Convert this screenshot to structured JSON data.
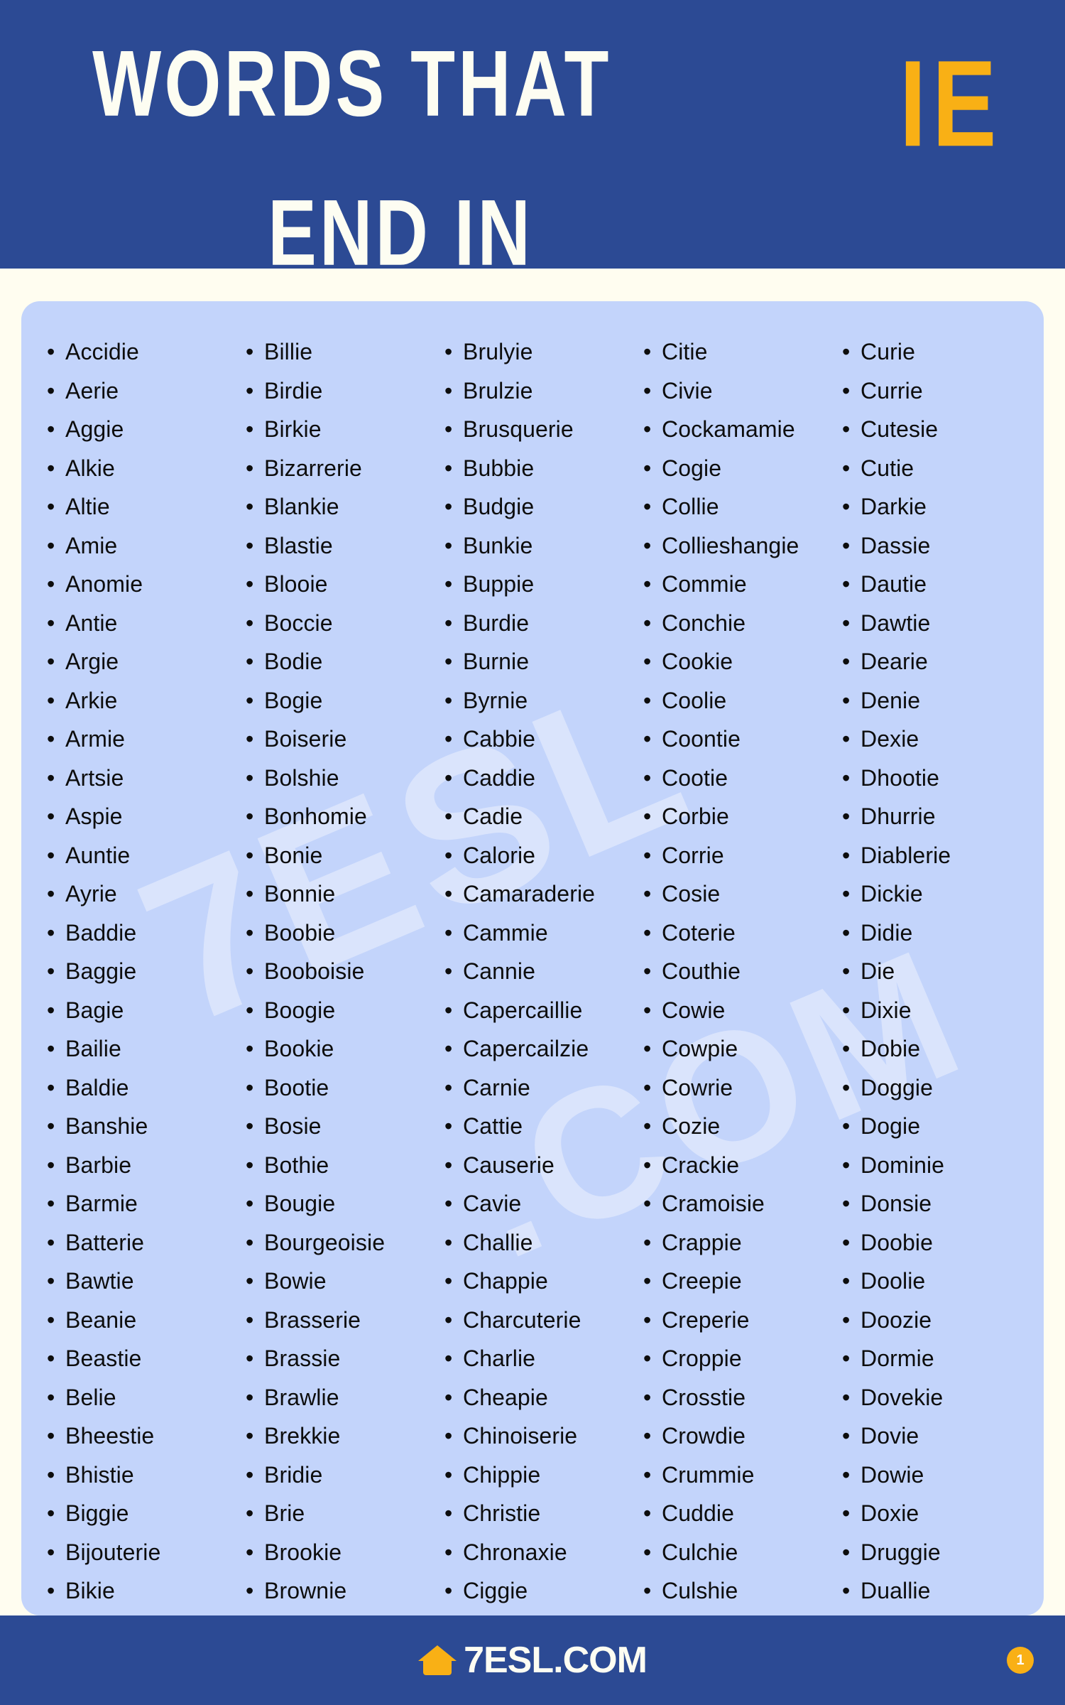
{
  "header": {
    "title_line_1": "WORDS THAT",
    "title_line_2": "END IN",
    "badge": "IE",
    "bg_color": "#2c4a94",
    "badge_color": "#f9b015",
    "title_color": "#fdfdf2"
  },
  "card": {
    "bg_color": "#c3d4fb",
    "bullet": "•"
  },
  "watermark": {
    "text_1": "7ESL",
    "text_2": ".COM"
  },
  "footer": {
    "logo_number": "7",
    "logo_text": "ESL.COM",
    "page_number": "1",
    "bg_color": "#2c4a94",
    "accent_color": "#f9b015"
  },
  "columns": [
    {
      "id": "column-1",
      "words": [
        "Accidie",
        "Aerie",
        "Aggie",
        "Alkie",
        "Altie",
        "Amie",
        "Anomie",
        "Antie",
        "Argie",
        "Arkie",
        "Armie",
        "Artsie",
        "Aspie",
        "Auntie",
        "Ayrie",
        "Baddie",
        "Baggie",
        "Bagie",
        "Bailie",
        "Baldie",
        "Banshie",
        "Barbie",
        "Barmie",
        "Batterie",
        "Bawtie",
        "Beanie",
        "Beastie",
        "Belie",
        "Bheestie",
        "Bhistie",
        "Biggie",
        "Bijouterie",
        "Bikie"
      ]
    },
    {
      "id": "column-2",
      "words": [
        "Billie",
        "Birdie",
        "Birkie",
        "Bizarrerie",
        "Blankie",
        "Blastie",
        "Blooie",
        "Boccie",
        "Bodie",
        "Bogie",
        "Boiserie",
        "Bolshie",
        "Bonhomie",
        "Bonie",
        "Bonnie",
        "Boobie",
        "Booboisie",
        "Boogie",
        "Bookie",
        "Bootie",
        "Bosie",
        "Bothie",
        "Bougie",
        "Bourgeoisie",
        "Bowie",
        "Brasserie",
        "Brassie",
        "Brawlie",
        "Brekkie",
        "Bridie",
        "Brie",
        "Brookie",
        "Brownie"
      ]
    },
    {
      "id": "column-3",
      "words": [
        "Brulyie",
        "Brulzie",
        "Brusquerie",
        "Bubbie",
        "Budgie",
        "Bunkie",
        "Buppie",
        "Burdie",
        "Burnie",
        "Byrnie",
        "Cabbie",
        "Caddie",
        "Cadie",
        "Calorie",
        "Camaraderie",
        "Cammie",
        "Cannie",
        "Capercaillie",
        "Capercailzie",
        "Carnie",
        "Cattie",
        "Causerie",
        "Cavie",
        "Challie",
        "Chappie",
        "Charcuterie",
        "Charlie",
        "Cheapie",
        "Chinoiserie",
        "Chippie",
        "Christie",
        "Chronaxie",
        "Ciggie"
      ]
    },
    {
      "id": "column-4",
      "words": [
        "Citie",
        "Civie",
        "Cockamamie",
        "Cogie",
        "Collie",
        "Collieshangie",
        "Commie",
        "Conchie",
        "Cookie",
        "Coolie",
        "Coontie",
        "Cootie",
        "Corbie",
        "Corrie",
        "Cosie",
        "Coterie",
        "Couthie",
        "Cowie",
        "Cowpie",
        "Cowrie",
        "Cozie",
        "Crackie",
        "Cramoisie",
        "Crappie",
        "Creepie",
        "Creperie",
        "Croppie",
        "Crosstie",
        "Crowdie",
        "Crummie",
        "Cuddie",
        "Culchie",
        "Culshie"
      ]
    },
    {
      "id": "column-5",
      "words": [
        "Curie",
        "Currie",
        "Cutesie",
        "Cutie",
        "Darkie",
        "Dassie",
        "Dautie",
        "Dawtie",
        "Dearie",
        "Denie",
        "Dexie",
        "Dhootie",
        "Dhurrie",
        "Diablerie",
        "Dickie",
        "Didie",
        "Die",
        "Dixie",
        "Dobie",
        "Doggie",
        "Dogie",
        "Dominie",
        "Donsie",
        "Doobie",
        "Doolie",
        "Doozie",
        "Dormie",
        "Dovekie",
        "Dovie",
        "Dowie",
        "Doxie",
        "Druggie",
        "Duallie"
      ]
    }
  ]
}
